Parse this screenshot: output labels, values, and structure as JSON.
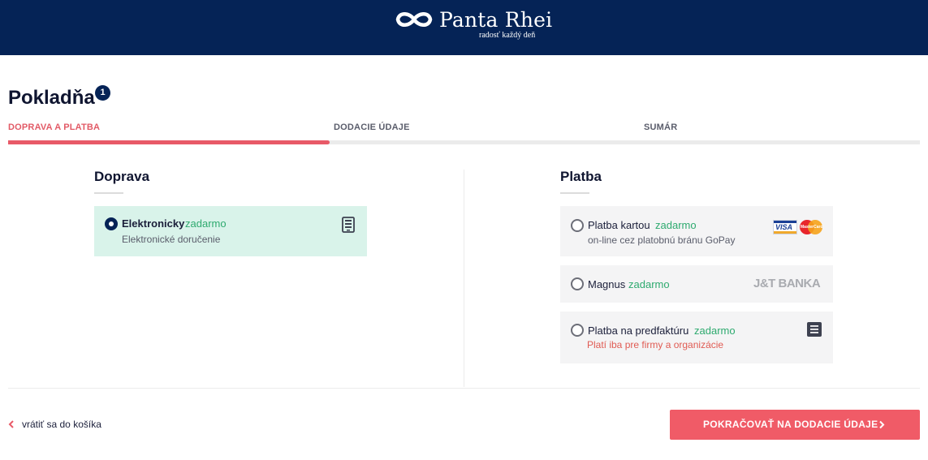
{
  "header": {
    "brand": "Panta Rhei",
    "tagline": "radosť každý deň"
  },
  "page": {
    "title": "Pokladňa",
    "badge": "1"
  },
  "steps": [
    {
      "label": "DOPRAVA A PLATBA",
      "active": true
    },
    {
      "label": "DODACIE ÚDAJE",
      "active": false
    },
    {
      "label": "SUMÁR",
      "active": false
    }
  ],
  "progress": {
    "fraction": 0.353
  },
  "shipping": {
    "title": "Doprava",
    "options": [
      {
        "name": "Elektronicky",
        "price": "zadarmo",
        "subtitle": "Elektronické doručenie",
        "selected": true,
        "icon": "ebook-icon"
      }
    ]
  },
  "payment": {
    "title": "Platba",
    "options": [
      {
        "name": "Platba kartou",
        "price": "zadarmo",
        "subtitle": "on-line cez platobnú bránu GoPay",
        "selected": false,
        "logos": [
          "visa-logo",
          "mastercard-logo"
        ],
        "visa_text": "VISA",
        "mc_text": "MasterCard"
      },
      {
        "name": "Magnus",
        "price": "zadarmo",
        "selected": false,
        "logo_text": "J&T BANKA"
      },
      {
        "name": "Platba na predfaktúru",
        "price": "zadarmo",
        "note": "Platí iba pre firmy a organizácie",
        "selected": false,
        "icon": "invoice-icon"
      }
    ]
  },
  "footer": {
    "back_label": "vrátiť sa do košíka",
    "continue_label": "POKRAČOVAŤ NA DODACIE ÚDAJE"
  },
  "colors": {
    "header": "#052356",
    "accent": "#f05b67",
    "free": "#2eaa6f",
    "selected_bg": "#d9f3ea",
    "warning": "#e05b53"
  }
}
